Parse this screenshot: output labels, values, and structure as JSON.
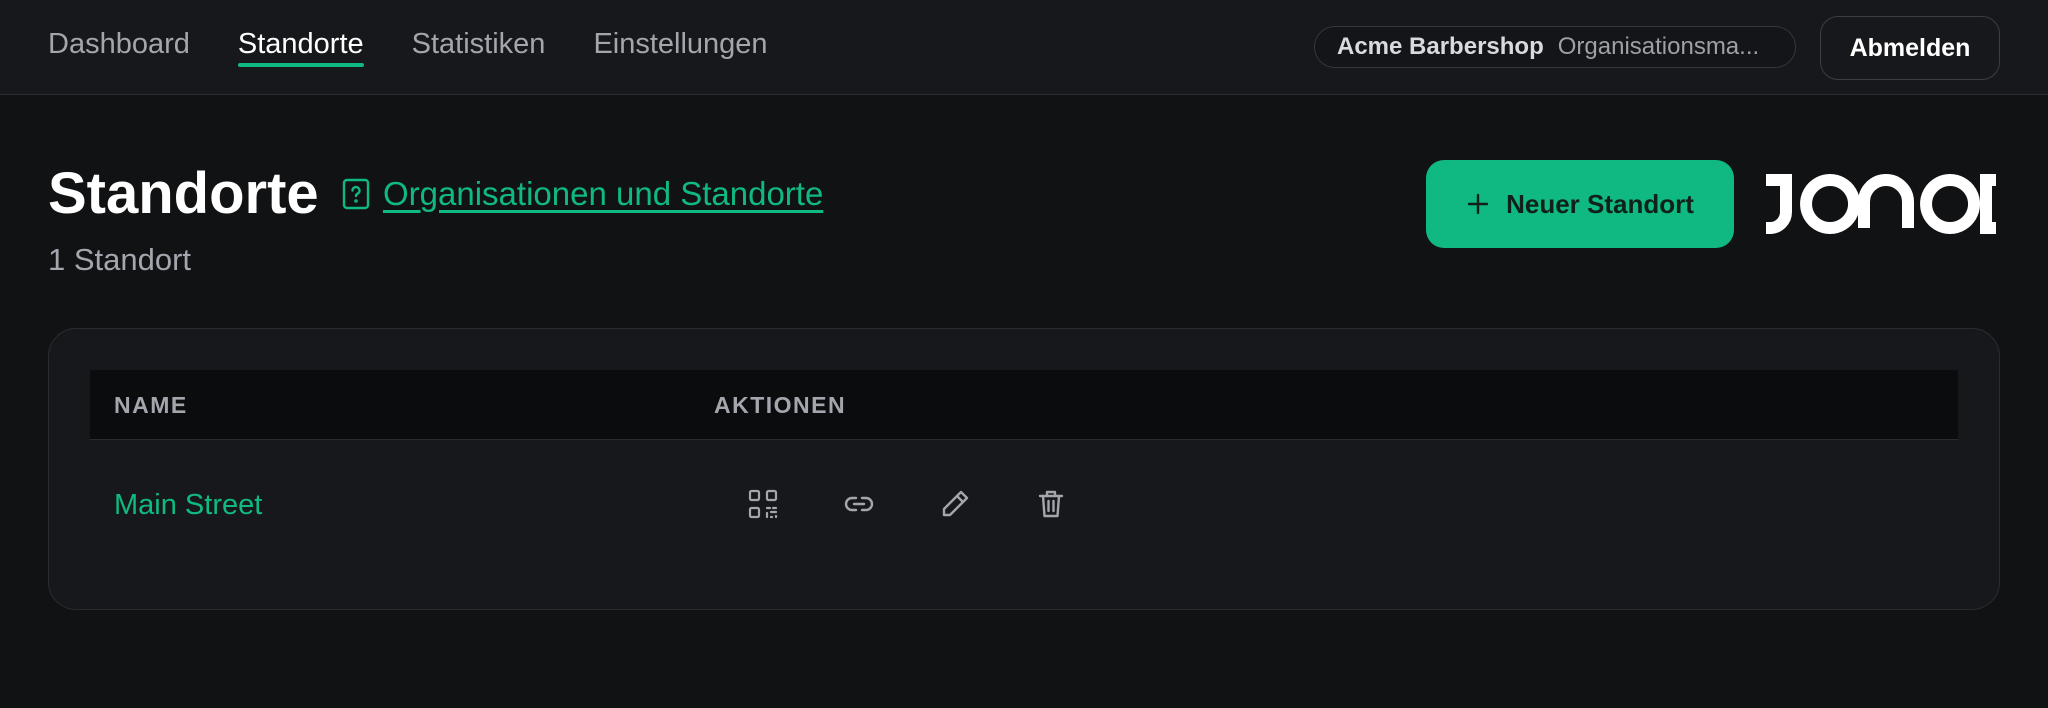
{
  "nav": {
    "items": [
      {
        "label": "Dashboard",
        "active": false
      },
      {
        "label": "Standorte",
        "active": true
      },
      {
        "label": "Statistiken",
        "active": false
      },
      {
        "label": "Einstellungen",
        "active": false
      }
    ]
  },
  "org": {
    "name": "Acme Barbershop",
    "role": "Organisationsma..."
  },
  "logout_label": "Abmelden",
  "header": {
    "title": "Standorte",
    "help_link": "Organisationen und Standorte",
    "count": "1 Standort",
    "new_button": "Neuer Standort"
  },
  "brand": {
    "logo_text": "JONOT"
  },
  "table": {
    "columns": [
      "NAME",
      "AKTIONEN"
    ],
    "rows": [
      {
        "name": "Main Street",
        "actions": [
          "qr-code-icon",
          "link-icon",
          "edit-icon",
          "trash-icon"
        ]
      }
    ]
  },
  "colors": {
    "accent": "#10b981",
    "background": "#111214",
    "surface": "#17181b"
  }
}
